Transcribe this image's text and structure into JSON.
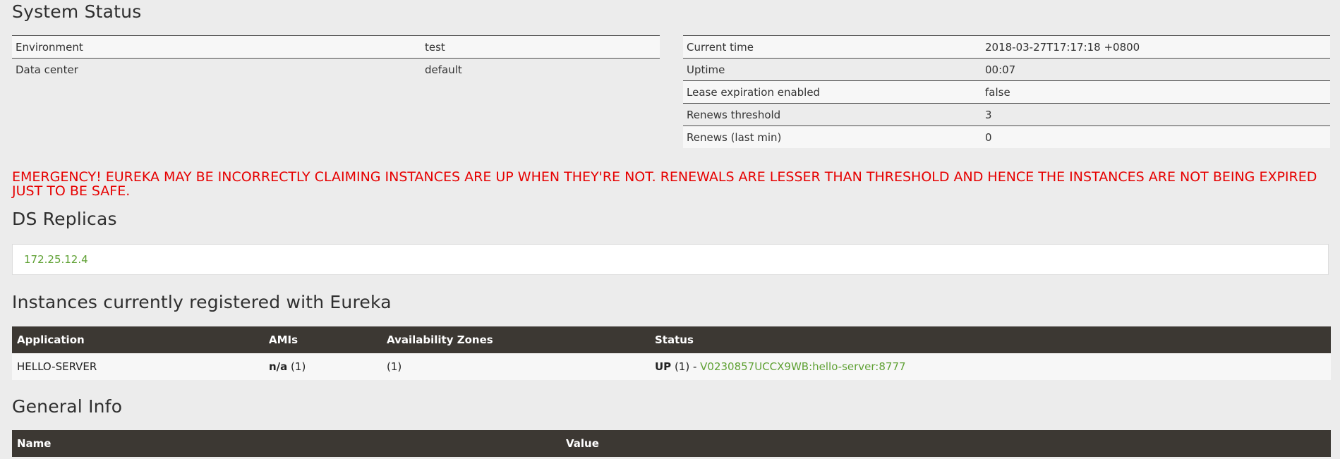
{
  "system_status": {
    "title": "System Status",
    "left_rows": [
      {
        "label": "Environment",
        "value": "test"
      },
      {
        "label": "Data center",
        "value": "default"
      }
    ],
    "right_rows": [
      {
        "label": "Current time",
        "value": "2018-03-27T17:17:18 +0800"
      },
      {
        "label": "Uptime",
        "value": "00:07"
      },
      {
        "label": "Lease expiration enabled",
        "value": "false"
      },
      {
        "label": "Renews threshold",
        "value": "3"
      },
      {
        "label": "Renews (last min)",
        "value": "0"
      }
    ]
  },
  "emergency_message": "EMERGENCY! EUREKA MAY BE INCORRECTLY CLAIMING INSTANCES ARE UP WHEN THEY'RE NOT. RENEWALS ARE LESSER THAN THRESHOLD AND HENCE THE INSTANCES ARE NOT BEING EXPIRED JUST TO BE SAFE.",
  "ds_replicas": {
    "title": "DS Replicas",
    "items": [
      "172.25.12.4"
    ]
  },
  "instances": {
    "title": "Instances currently registered with Eureka",
    "headers": [
      "Application",
      "AMIs",
      "Availability Zones",
      "Status"
    ],
    "rows": [
      {
        "application": "HELLO-SERVER",
        "amis_bold": "n/a",
        "amis_count": " (1)",
        "zones": "(1)",
        "status_bold": "UP",
        "status_count": " (1) - ",
        "instance_link": "V0230857UCCX9WB:hello-server:8777"
      }
    ]
  },
  "general_info": {
    "title": "General Info",
    "headers": [
      "Name",
      "Value"
    ]
  },
  "colors": {
    "emergency": "#e60000",
    "link_green": "#5fa134",
    "header_dark": "#3c3833"
  }
}
